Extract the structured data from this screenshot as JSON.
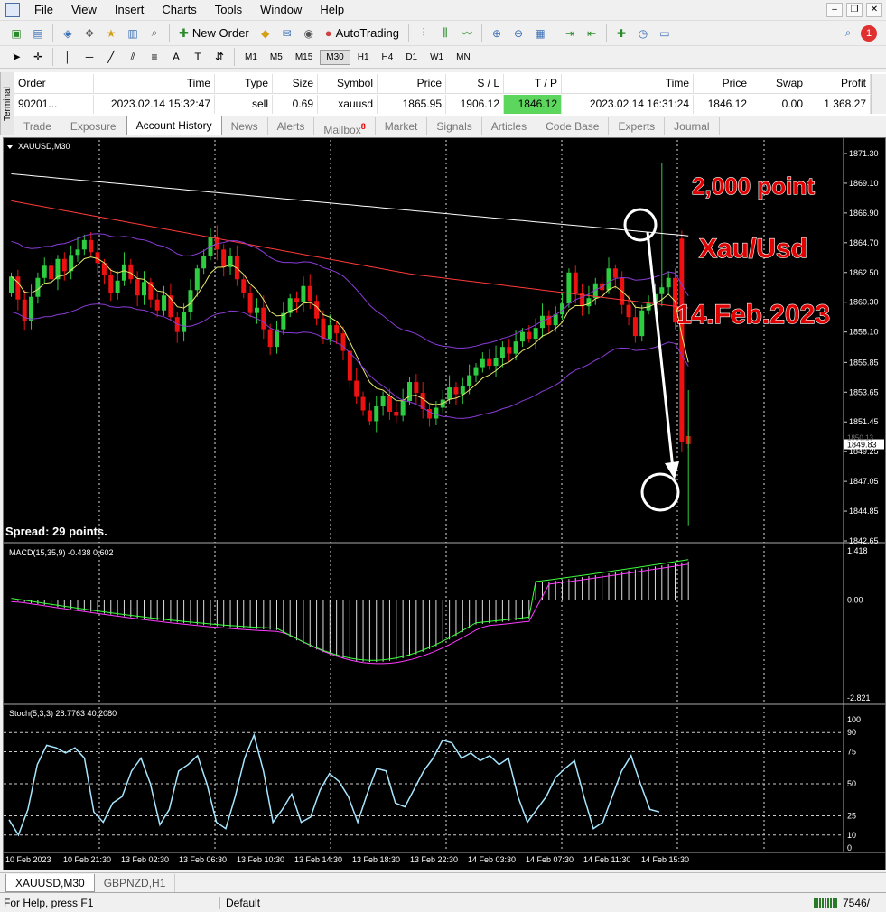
{
  "menu": [
    "File",
    "View",
    "Insert",
    "Charts",
    "Tools",
    "Window",
    "Help"
  ],
  "toolbar": {
    "new_order": "New Order",
    "autotrading": "AutoTrading"
  },
  "timeframes": [
    "M1",
    "M5",
    "M15",
    "M30",
    "H1",
    "H4",
    "D1",
    "W1",
    "MN"
  ],
  "active_timeframe": "M30",
  "terminal": {
    "side_label": "Terminal",
    "columns": [
      "Order",
      "Time",
      "Type",
      "Size",
      "Symbol",
      "Price",
      "S / L",
      "T / P",
      "Time",
      "Price",
      "Swap",
      "Profit"
    ],
    "row": [
      "90201...",
      "2023.02.14 15:32:47",
      "sell",
      "0.69",
      "xauusd",
      "1865.95",
      "1906.12",
      "1846.12",
      "2023.02.14 16:31:24",
      "1846.12",
      "0.00",
      "1 368.27"
    ],
    "tabs": [
      "Trade",
      "Exposure",
      "Account History",
      "News",
      "Alerts",
      "Mailbox",
      "Market",
      "Signals",
      "Articles",
      "Code Base",
      "Experts",
      "Journal"
    ],
    "mailbox_badge": "8",
    "active_tab": "Account History"
  },
  "chart": {
    "symbol_label": "XAUUSD,M30",
    "spread": "Spread: 29 points.",
    "annotations": [
      "2,000 point",
      "Xau/Usd",
      "14.Feb.2023"
    ],
    "price_axis": [
      "1871.30",
      "1869.10",
      "1866.90",
      "1864.70",
      "1862.50",
      "1860.30",
      "1858.10",
      "1855.85",
      "1853.65",
      "1851.45",
      "1849.25",
      "1847.05",
      "1844.85",
      "1842.65"
    ],
    "current_price": "1849.83",
    "other_price_tag": "1850.13",
    "macd_label": "MACD(15,35,9) -0.438 0.602",
    "macd_axis": [
      "1.418",
      "0.00",
      "-2.821"
    ],
    "stoch_label": "Stoch(5,3,3) 28.7763 40.2080",
    "stoch_axis": [
      "100",
      "90",
      "75",
      "50",
      "25",
      "10",
      "0"
    ],
    "time_axis": [
      "10 Feb 2023",
      "10 Feb 21:30",
      "13 Feb 02:30",
      "13 Feb 06:30",
      "13 Feb 10:30",
      "13 Feb 14:30",
      "13 Feb 18:30",
      "13 Feb 22:30",
      "14 Feb 03:30",
      "14 Feb 07:30",
      "14 Feb 11:30",
      "14 Feb 15:30"
    ],
    "colors": {
      "bull": "#2ecc40",
      "bear": "#ee1111",
      "ma_slow": "#ffffff",
      "ma_mid": "#ff3a3a",
      "bands": "#8a3cd6",
      "ma_fast": "#e8e870",
      "macd_sig": "#ff3cff",
      "macd_main": "#3cff3c",
      "stoch": "#a8e6ff",
      "annot": "#e00000"
    }
  },
  "bottom_tabs": [
    "XAUUSD,M30",
    "GBPNZD,H1"
  ],
  "status": {
    "help": "For Help, press F1",
    "profile": "Default",
    "traffic": "7546/"
  }
}
